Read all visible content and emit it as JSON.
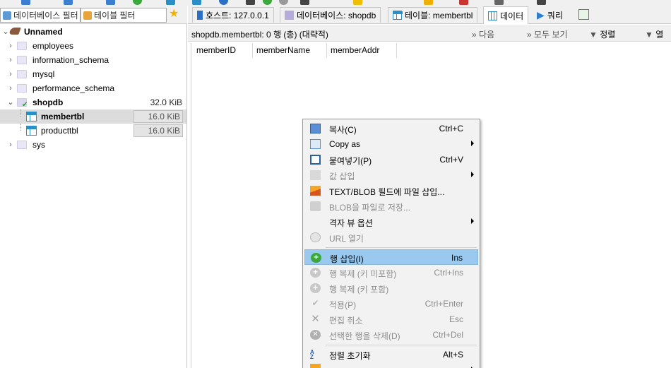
{
  "left_panel": {
    "db_filter_placeholder": "데이터베이스 필터",
    "table_filter_placeholder": "테이블 필터",
    "tree": {
      "connection": "Unnamed",
      "databases": [
        {
          "name": "employees"
        },
        {
          "name": "information_schema"
        },
        {
          "name": "mysql"
        },
        {
          "name": "performance_schema"
        },
        {
          "name": "shopdb",
          "size": "32.0 KiB",
          "tables": [
            {
              "name": "membertbl",
              "size": "16.0 KiB"
            },
            {
              "name": "producttbl",
              "size": "16.0 KiB"
            }
          ]
        },
        {
          "name": "sys"
        }
      ]
    }
  },
  "tabs": [
    {
      "label": "호스트: 127.0.0.1",
      "icon": "host-icon"
    },
    {
      "label": "데이터베이스: shopdb",
      "icon": "database-icon"
    },
    {
      "label": "테이블: membertbl",
      "icon": "table-icon"
    },
    {
      "label": "데이터",
      "icon": "data-grid-icon"
    },
    {
      "label": "쿼리",
      "icon": "play-icon"
    }
  ],
  "data_view": {
    "title": "shopdb.membertbl: 0 행 (총) (대략적)",
    "next_label": "다음",
    "show_all_label": "모두 보기",
    "sort_label": "정렬",
    "columns_label": "열",
    "columns": [
      "memberID",
      "memberName",
      "memberAddr"
    ]
  },
  "context_menu": {
    "items": [
      {
        "label": "복사(C)",
        "shortcut": "Ctrl+C",
        "icon": "copy-icon",
        "enabled": true
      },
      {
        "label": "Copy as",
        "shortcut": "",
        "icon": "copy-as-icon",
        "enabled": true,
        "submenu": true
      },
      {
        "label": "붙여넣기(P)",
        "shortcut": "Ctrl+V",
        "icon": "paste-icon",
        "enabled": true
      },
      {
        "label": "값 삽입",
        "shortcut": "",
        "icon": "insert-value-icon",
        "enabled": false,
        "submenu": true
      },
      {
        "label": "TEXT/BLOB 필드에 파일 삽입...",
        "shortcut": "",
        "icon": "image-file-icon",
        "enabled": true
      },
      {
        "label": "BLOB을 파일로 저장...",
        "shortcut": "",
        "icon": "save-blob-icon",
        "enabled": false
      },
      {
        "label": "격자 뷰 옵션",
        "shortcut": "",
        "icon": "",
        "enabled": true,
        "submenu": true
      },
      {
        "label": "URL 열기",
        "shortcut": "",
        "icon": "globe-icon",
        "enabled": false
      },
      {
        "label": "행 삽입(I)",
        "shortcut": "Ins",
        "icon": "add-row-icon",
        "enabled": true,
        "highlighted": true
      },
      {
        "label": "행 복제 (키 미포함)",
        "shortcut": "Ctrl+Ins",
        "icon": "duplicate-row-icon",
        "enabled": false
      },
      {
        "label": "행 복제 (키 포함)",
        "shortcut": "",
        "icon": "duplicate-row-key-icon",
        "enabled": false
      },
      {
        "label": "적용(P)",
        "shortcut": "Ctrl+Enter",
        "icon": "check-icon",
        "enabled": false
      },
      {
        "label": "편집 취소",
        "shortcut": "Esc",
        "icon": "cancel-icon",
        "enabled": false
      },
      {
        "label": "선택한 행을 삭제(D)",
        "shortcut": "Ctrl+Del",
        "icon": "delete-row-icon",
        "enabled": false
      },
      {
        "label": "정렬 초기화",
        "shortcut": "Alt+S",
        "icon": "sort-reset-icon",
        "enabled": true
      }
    ]
  },
  "colors": {
    "menu_highlight": "#99c9ef",
    "tree_selection": "#dcdcdc",
    "table_icon": "#2b8fc7",
    "add_row_icon": "#3aa83a"
  }
}
